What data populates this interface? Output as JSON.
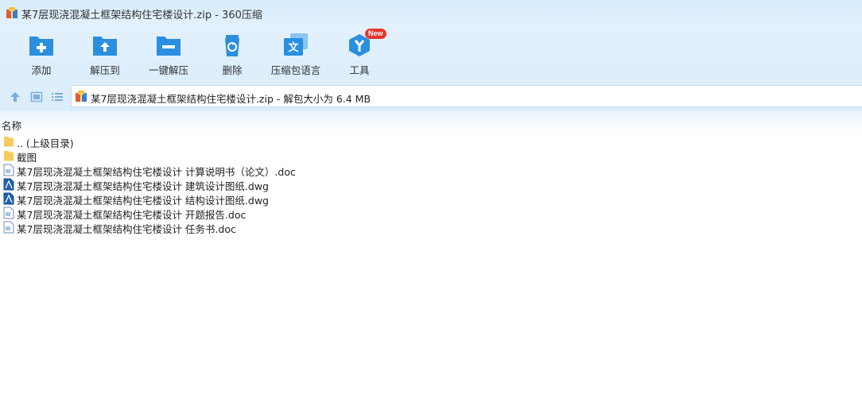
{
  "window": {
    "title": "某7层现浇混凝土框架结构住宅楼设计.zip - 360压缩"
  },
  "toolbar": {
    "buttons": [
      {
        "label": "添加",
        "icon": "add-folder-icon"
      },
      {
        "label": "解压到",
        "icon": "extract-folder-icon"
      },
      {
        "label": "一键解压",
        "icon": "quick-extract-icon"
      },
      {
        "label": "删除",
        "icon": "recycle-bin-icon"
      },
      {
        "label": "压缩包语言",
        "icon": "language-icon"
      },
      {
        "label": "工具",
        "icon": "tools-icon",
        "badge": "New"
      }
    ]
  },
  "address": {
    "path": "某7层现浇混凝土框架结构住宅楼设计.zip - 解包大小为 6.4 MB"
  },
  "list": {
    "column_name": "名称",
    "items": [
      {
        "name": ".. (上级目录)",
        "type": "folder"
      },
      {
        "name": "截图",
        "type": "folder"
      },
      {
        "name": "某7层现浇混凝土框架结构住宅楼设计 计算说明书（论文）.doc",
        "type": "doc"
      },
      {
        "name": "某7层现浇混凝土框架结构住宅楼设计 建筑设计图纸.dwg",
        "type": "dwg"
      },
      {
        "name": "某7层现浇混凝土框架结构住宅楼设计 结构设计图纸.dwg",
        "type": "dwg"
      },
      {
        "name": "某7层现浇混凝土框架结构住宅楼设计 开题报告.doc",
        "type": "doc"
      },
      {
        "name": "某7层现浇混凝土框架结构住宅楼设计 任务书.doc",
        "type": "doc"
      }
    ]
  },
  "colors": {
    "accent": "#2a8fe0",
    "folder": "#f5cd5e",
    "badge": "#e8352f"
  }
}
